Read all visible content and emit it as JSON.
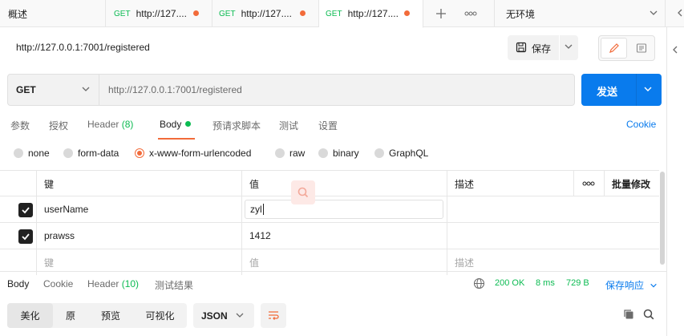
{
  "tabbar": {
    "overview_label": "概述",
    "tabs": [
      {
        "method": "GET",
        "label": "http://127...."
      },
      {
        "method": "GET",
        "label": "http://127...."
      },
      {
        "method": "GET",
        "label": "http://127...."
      }
    ],
    "environment": "无环境"
  },
  "request": {
    "title": "http://127.0.0.1:7001/registered",
    "save_label": "保存",
    "method": "GET",
    "url": "http://127.0.0.1:7001/registered",
    "send_label": "发送"
  },
  "request_tabs": {
    "params": "参数",
    "auth": "授权",
    "headers": "Header",
    "headers_count": "(8)",
    "body": "Body",
    "pre_request": "预请求脚本",
    "tests": "测试",
    "settings": "设置",
    "cookie": "Cookie"
  },
  "body_types": [
    "none",
    "form-data",
    "x-www-form-urlencoded",
    "raw",
    "binary",
    "GraphQL"
  ],
  "body_type_selected": "x-www-form-urlencoded",
  "params_table": {
    "headers": {
      "key": "键",
      "value": "值",
      "description": "描述",
      "more": "ooo",
      "bulk_edit": "批量修改"
    },
    "rows": [
      {
        "checked": true,
        "key": "userName",
        "value": "zyl",
        "description": ""
      },
      {
        "checked": true,
        "key": "prawss",
        "value": "1412",
        "description": ""
      }
    ],
    "placeholder": {
      "key": "键",
      "value": "值",
      "description": "描述"
    }
  },
  "response": {
    "tabs": {
      "body": "Body",
      "cookie": "Cookie",
      "headers": "Header",
      "headers_count": "(10)",
      "test_results": "测试结果"
    },
    "status": "200 OK",
    "time": "8 ms",
    "size": "729 B",
    "save_response": "保存响应",
    "view_modes": [
      "美化",
      "原",
      "预览",
      "可视化"
    ],
    "view_mode_selected": "美化",
    "format": "JSON"
  },
  "colors": {
    "accent_orange": "#f26b3a",
    "primary_blue": "#097bed",
    "success_green": "#0cbb52"
  }
}
